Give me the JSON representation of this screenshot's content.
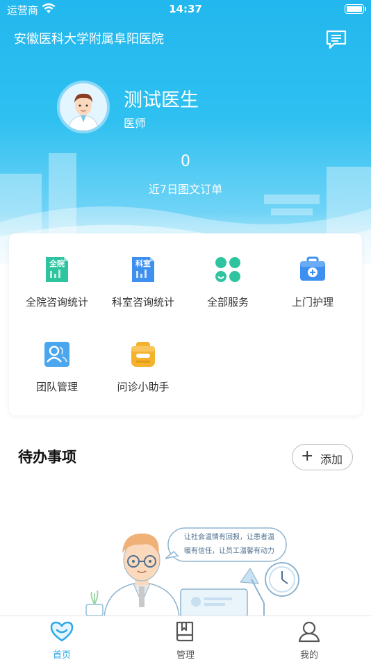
{
  "status_bar": {
    "carrier": "运营商",
    "time": "14:37"
  },
  "header": {
    "hospital_name": "安徽医科大学附属阜阳医院",
    "message_icon": "message-icon"
  },
  "profile": {
    "name": "测试医生",
    "title": "医师",
    "order_count": "0",
    "order_label": "近7日图文订单"
  },
  "functions": [
    {
      "label": "全院咨询统计",
      "icon": "hospital-stats-icon",
      "badge": "全院",
      "color": "#27c39a"
    },
    {
      "label": "科室咨询统计",
      "icon": "department-stats-icon",
      "badge": "科室",
      "color": "#3d8ff0"
    },
    {
      "label": "全部服务",
      "icon": "all-services-icon",
      "color": "#27c39a"
    },
    {
      "label": "上门护理",
      "icon": "home-care-icon",
      "color": "#3d8ff0"
    },
    {
      "label": "团队管理",
      "icon": "team-management-icon",
      "color": "#4aa6ee"
    },
    {
      "label": "问诊小助手",
      "icon": "assistant-icon",
      "color": "#f5b22d"
    }
  ],
  "todo": {
    "title": "待办事项",
    "add_label": "添加",
    "empty_message_line1": "让社会温情有回报，让患者温",
    "empty_message_line2": "暖有信任，让员工温馨有动力"
  },
  "tabs": [
    {
      "label": "首页",
      "icon": "home-heart-icon",
      "active": true
    },
    {
      "label": "管理",
      "icon": "book-icon",
      "active": false
    },
    {
      "label": "我的",
      "icon": "person-icon",
      "active": false
    }
  ],
  "colors": {
    "primary": "#2ba8e8",
    "hero_top": "#22b7ee"
  }
}
